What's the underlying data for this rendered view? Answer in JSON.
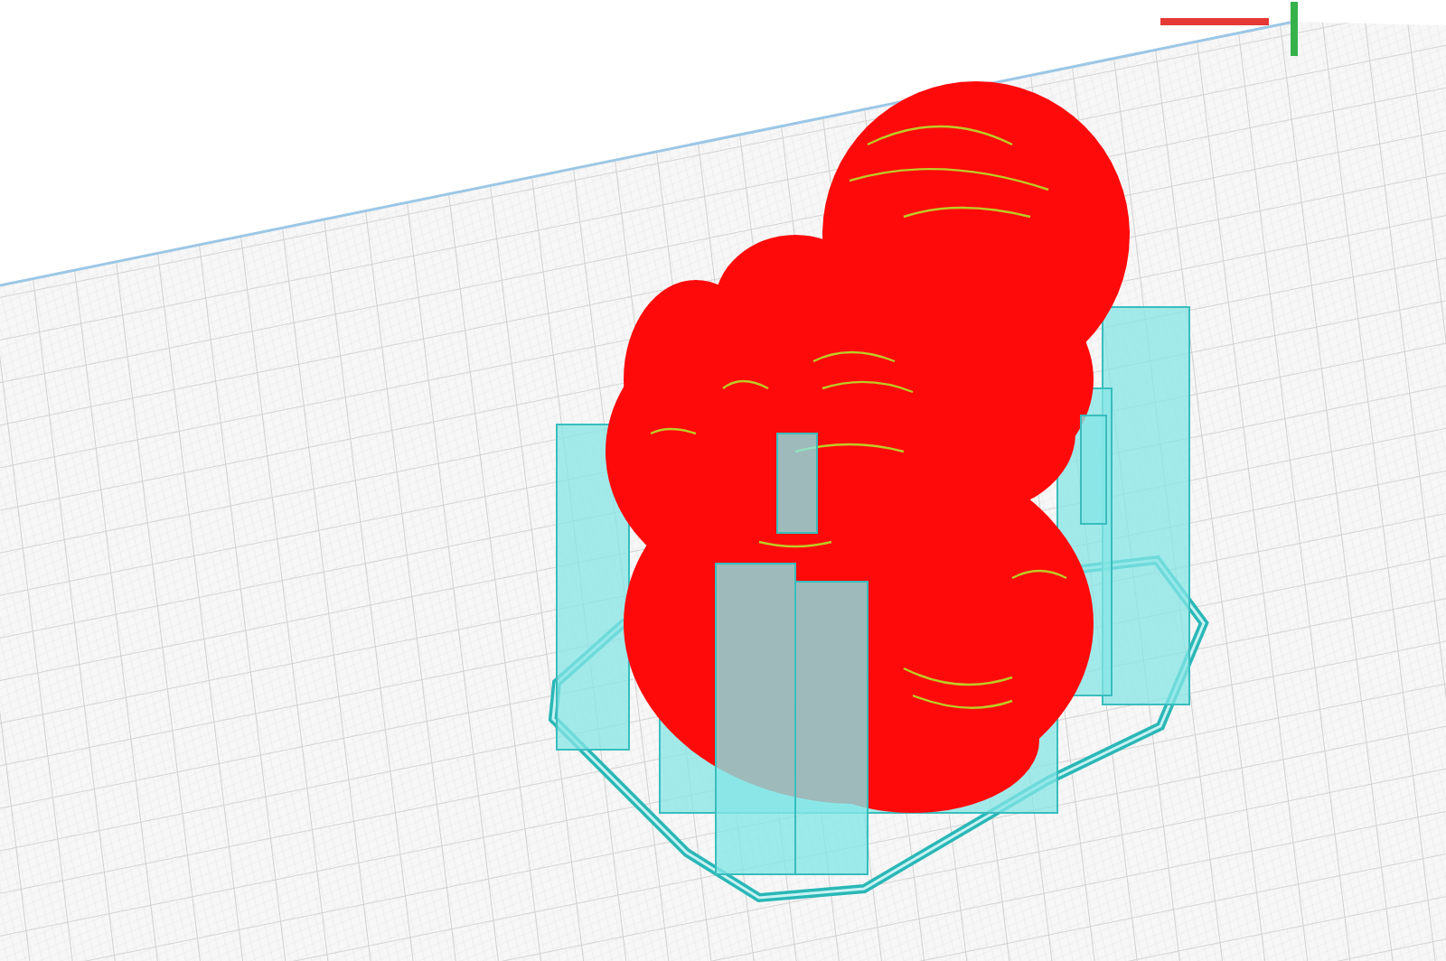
{
  "viewport": {
    "axes": [
      {
        "color": "#e53935"
      },
      {
        "color": "#36b24a"
      }
    ]
  }
}
